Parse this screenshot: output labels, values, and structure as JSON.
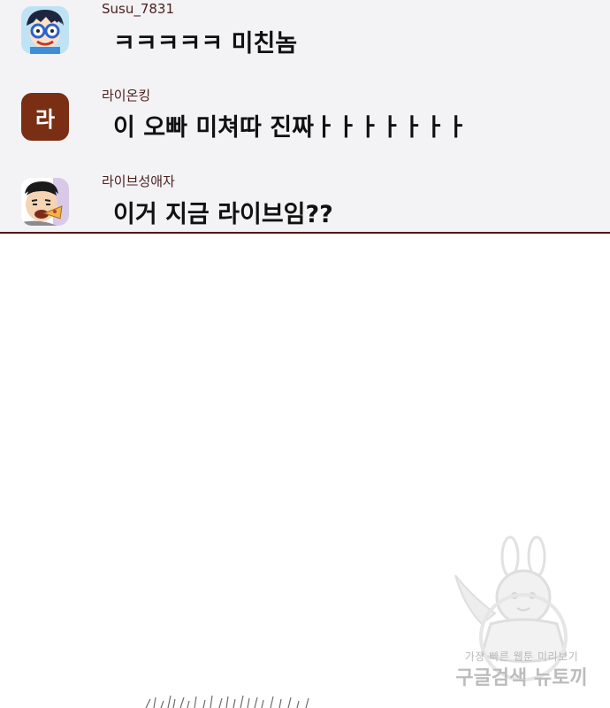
{
  "comments": [
    {
      "username": "Susu_7831",
      "message": "ㅋㅋㅋㅋㅋ 미친놈",
      "avatar_icon": "cartoon-boy-glasses-icon"
    },
    {
      "username": "라이온킹",
      "message": "이 오빠 미쳐따 진짜ㅏㅏㅏㅏㅏㅏㅏ",
      "avatar_letter": "라",
      "avatar_color": "#7a2e13"
    },
    {
      "username": "라이브성애자",
      "message": "이거 지금 라이브임??",
      "avatar_icon": "cartoon-man-eating-icon"
    }
  ],
  "watermark": {
    "line1": "가장 빠른 웹툰 미리보기",
    "line2": "구글검색 뉴토끼",
    "icon": "bunny-girl-mascot-icon"
  },
  "colors": {
    "panel_bg": "#f3f2f4",
    "divider": "#5a1616",
    "username": "#4a1f1f"
  }
}
